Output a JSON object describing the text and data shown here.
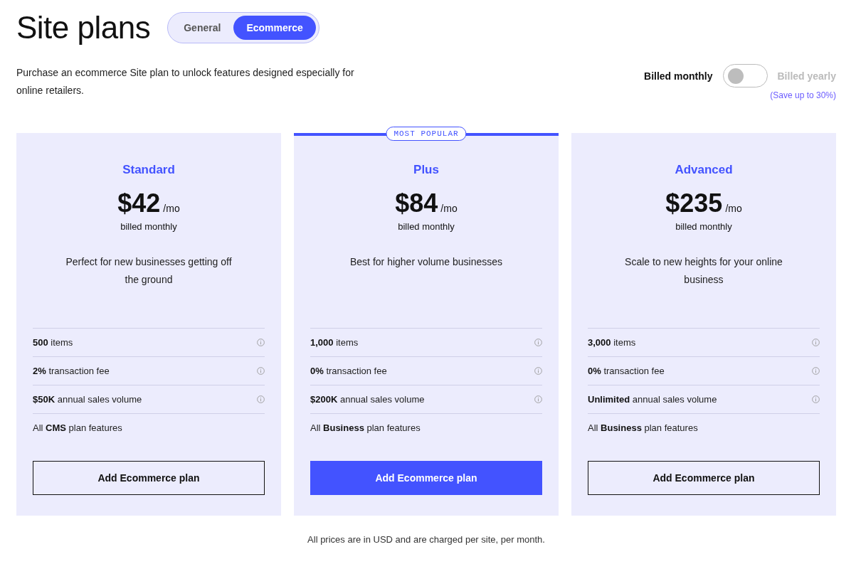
{
  "title": "Site plans",
  "tabs": [
    {
      "label": "General",
      "selected": false
    },
    {
      "label": "Ecommerce",
      "selected": true
    }
  ],
  "intro": "Purchase an ecommerce Site plan to unlock features designed especially for online retailers.",
  "billing": {
    "monthly_label": "Billed monthly",
    "yearly_label": "Billed yearly",
    "yearly": false,
    "savings": "(Save up to 30%)"
  },
  "plans": [
    {
      "name": "Standard",
      "price": "$42",
      "unit": "/mo",
      "billing": "billed monthly",
      "description": "Perfect for new businesses getting off the ground",
      "featured": false,
      "features": [
        {
          "text": "**500** items",
          "info": true
        },
        {
          "text": "**2%** transaction fee",
          "info": true
        },
        {
          "text": "**$50K** annual sales volume",
          "info": true
        },
        {
          "text": "All **CMS** plan features",
          "info": false
        }
      ],
      "button": "Add Ecommerce plan"
    },
    {
      "name": "Plus",
      "badge": "MOST POPULAR",
      "price": "$84",
      "unit": "/mo",
      "billing": "billed monthly",
      "description": "Best for higher volume businesses",
      "featured": true,
      "features": [
        {
          "text": "**1,000** items",
          "info": true
        },
        {
          "text": "**0%** transaction fee",
          "info": true
        },
        {
          "text": "**$200K** annual sales volume",
          "info": true
        },
        {
          "text": "All **Business** plan features",
          "info": false
        }
      ],
      "button": "Add Ecommerce plan"
    },
    {
      "name": "Advanced",
      "price": "$235",
      "unit": "/mo",
      "billing": "billed monthly",
      "description": "Scale to new heights for your online business",
      "featured": false,
      "features": [
        {
          "text": "**3,000** items",
          "info": true
        },
        {
          "text": "**0%** transaction fee",
          "info": true
        },
        {
          "text": "**Unlimited** annual sales volume",
          "info": true
        },
        {
          "text": "All **Business** plan features",
          "info": false
        }
      ],
      "button": "Add Ecommerce plan"
    }
  ],
  "footnote": "All prices are in USD and are charged per site, per month."
}
